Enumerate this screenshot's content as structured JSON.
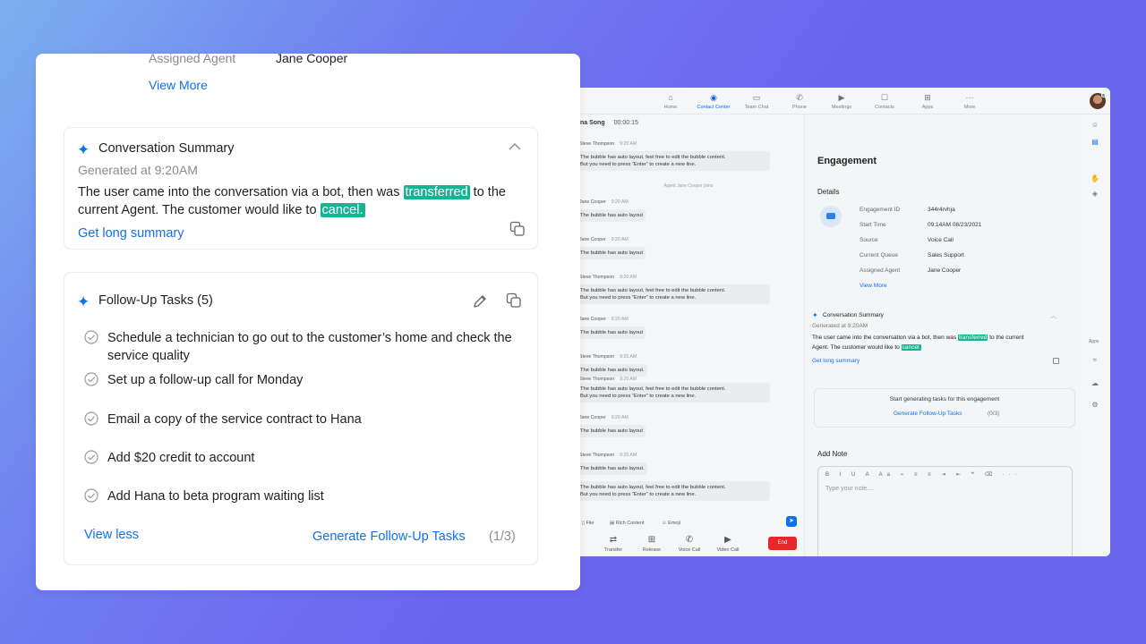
{
  "colors": {
    "accent": "#0e71eb",
    "highlight": "#14b495",
    "end": "#e8262c"
  },
  "app": {
    "nav": [
      {
        "label": "Home",
        "icon": "home-icon",
        "glyph": "⌂"
      },
      {
        "label": "Contact Center",
        "icon": "contact-center-icon",
        "glyph": "◉"
      },
      {
        "label": "Team Chat",
        "icon": "chat-icon",
        "glyph": "▭"
      },
      {
        "label": "Phone",
        "icon": "phone-icon",
        "glyph": "✆"
      },
      {
        "label": "Meetings",
        "icon": "video-icon",
        "glyph": "▶"
      },
      {
        "label": "Contacts",
        "icon": "contacts-icon",
        "glyph": "☐"
      },
      {
        "label": "Apps",
        "icon": "apps-icon",
        "glyph": "⊞"
      },
      {
        "label": "More",
        "icon": "more-icon",
        "glyph": "···"
      }
    ],
    "chat_header": {
      "name": "na Song",
      "timer": "00:00:15"
    },
    "messages": [
      {
        "sender": "Steve Thompson",
        "time": "9:20 AM",
        "lines": [
          "The bubble has auto layout, feel free to edit the bubble content.",
          "But you need to press “Enter” to create a new line."
        ]
      },
      {
        "sender": "Jane Cooper",
        "time": "9:20 AM",
        "lines": [
          "The bubble has auto layout"
        ]
      },
      {
        "sender": "Jane Cooper",
        "time": "9:20 AM",
        "lines": [
          "The bubble has auto layout"
        ]
      },
      {
        "sender": "Steve Thompson",
        "time": "9:20 AM",
        "lines": [
          "The bubble has auto layout, feel free to edit the bubble content.",
          "But you need to press “Enter” to create a new line."
        ]
      },
      {
        "sender": "Jane Cooper",
        "time": "9:20 AM",
        "lines": [
          "The bubble has auto layout"
        ]
      },
      {
        "sender": "Steve Thompson",
        "time": "9:20 AM",
        "lines": [
          "The bubble has auto layout."
        ]
      },
      {
        "sender": "Steve Thompson",
        "time": "9:20 AM",
        "lines": [
          "The bubble has auto layout, feel free to edit the bubble content.",
          "But you need to press “Enter” to create a new line."
        ]
      },
      {
        "sender": "Jane Cooper",
        "time": "9:20 AM",
        "lines": [
          "The bubble has auto layout"
        ]
      },
      {
        "sender": "Steve Thompson",
        "time": "9:20 AM",
        "lines": [
          "The bubble has auto layout."
        ]
      },
      {
        "sender": "",
        "time": "",
        "lines": [
          "The bubble has auto layout, feel free to edit the bubble content.",
          "But you need to press “Enter” to create a new line."
        ]
      }
    ],
    "system_line": "Agent Jane Cooper joins",
    "composer": {
      "file": "File",
      "rich": "Rich Content",
      "emoji": "Emoji"
    },
    "actions": [
      {
        "label": "Transfer",
        "glyph": "⇄"
      },
      {
        "label": "Release",
        "glyph": "⊞"
      },
      {
        "label": "Voice Call",
        "glyph": "✆"
      },
      {
        "label": "Video Call",
        "glyph": "▶"
      }
    ],
    "end_label": "End",
    "engagement": {
      "title": "Engagement",
      "details_title": "Details",
      "rows": [
        {
          "label": "Engagement ID",
          "value": "344r4rvhja"
        },
        {
          "label": "Start Time",
          "value": "09:14AM 08/23/2021"
        },
        {
          "label": "Source",
          "value": "Voice Call"
        },
        {
          "label": "Current Queue",
          "value": "Sales Support"
        },
        {
          "label": "Assigned Agent",
          "value": "Jane Cooper"
        }
      ],
      "view_more": "View More",
      "summary_title": "Conversation Summary",
      "summary_generated": "Generated at 9:20AM",
      "summary_pre": "The user came into the conversation via a bot, then was ",
      "summary_hl1": "transferred",
      "summary_mid": " to the current Agent. The customer would like to ",
      "summary_hl2": "cancel.",
      "summary_link": "Get long summary",
      "gen_prompt": "Start generating tasks for this engagement",
      "gen_link": "Generate Follow-Up Tasks",
      "gen_count": "(0/3)",
      "add_note": "Add Note",
      "note_toolbar": "B I U A Aa ⌁ ≡ ≡ ⇥ ⇤ ❝ ⌫ ···",
      "note_placeholder": "Type your note...."
    },
    "rail_apps": "Apps"
  },
  "card": {
    "assigned_label": "Assigned Agent",
    "assigned_value": "Jane Cooper",
    "view_more": "View More",
    "summary": {
      "title": "Conversation Summary",
      "generated": "Generated at 9:20AM",
      "text_pre": "The user came into the conversation via a bot, then was ",
      "hl1": "transferred",
      "text_mid": " to the current Agent. The customer would like to ",
      "hl2": "cancel.",
      "link": "Get long summary"
    },
    "tasks": {
      "title": "Follow-Up Tasks (5)",
      "items": [
        "Schedule a technician to go out to the customer’s home and check the service quality",
        "Set up a follow-up call for Monday",
        "Email a copy of the service contract to Hana",
        "Add $20 credit to account",
        "Add Hana to beta program waiting list"
      ],
      "view_less": "View less",
      "generate": "Generate Follow-Up Tasks",
      "count": "(1/3)"
    }
  }
}
